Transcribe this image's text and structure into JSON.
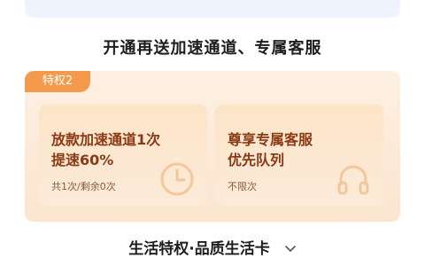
{
  "headline": "开通再送加速通道、专属客服",
  "perk": {
    "tag": "特权2",
    "cards": [
      {
        "title": "放款加速通道1次\n提速60%",
        "subtitle": "共1次/剩余0次",
        "icon": "clock-icon"
      },
      {
        "title": "尊享专属客服\n优先队列",
        "subtitle": "不限次",
        "icon": "headphones-icon"
      }
    ]
  },
  "footer": {
    "label": "生活特权·品质生活卡",
    "icon": "chevron-down-icon"
  },
  "colors": {
    "accent": "#f39a4c",
    "title": "#8a3a14",
    "panel": "#fbe5cf"
  }
}
